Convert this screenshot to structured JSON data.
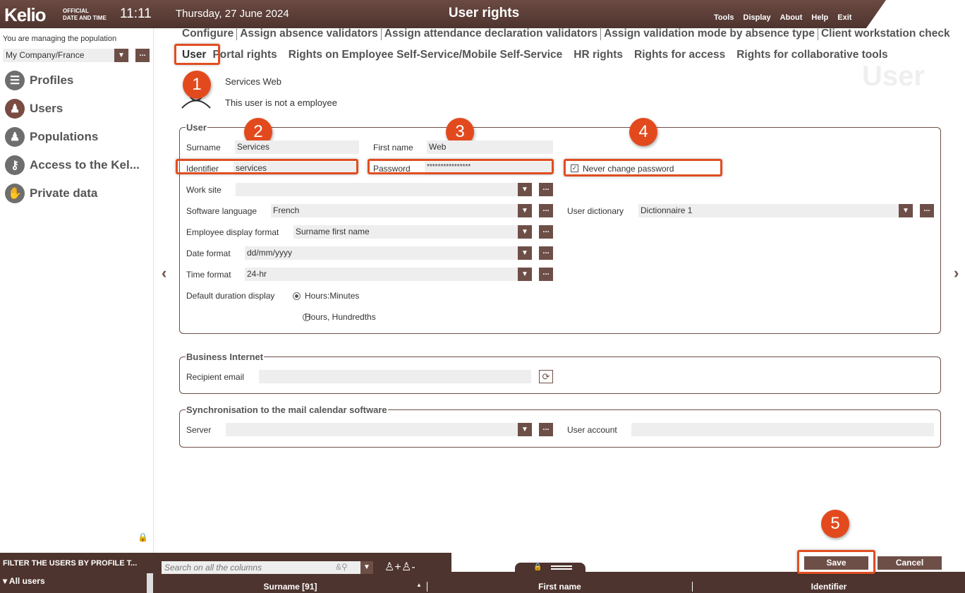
{
  "header": {
    "logo": "Kelio",
    "official_line1": "OFFICIAL",
    "official_line2": "DATE AND TIME",
    "clock": "11:11",
    "date": "Thursday, 27 June 2024",
    "title": "User rights",
    "menu": [
      "Tools",
      "Display",
      "About",
      "Help",
      "Exit"
    ]
  },
  "left": {
    "managing": "You are managing the population",
    "population": "My Company/France",
    "nav": [
      {
        "label": "Profiles",
        "icon": "profiles-icon"
      },
      {
        "label": "Users",
        "icon": "user-icon"
      },
      {
        "label": "Populations",
        "icon": "populations-icon"
      },
      {
        "label": "Access to the Kel...",
        "icon": "key-icon"
      },
      {
        "label": "Private data",
        "icon": "hand-icon"
      }
    ]
  },
  "tabs": {
    "row1": [
      "Configure",
      "Assign absence validators",
      "Assign attendance declaration validators",
      "Assign validation mode by absence type",
      "Client workstation check"
    ],
    "row2": [
      "User",
      "Portal rights",
      "Rights on Employee Self-Service/Mobile Self-Service",
      "HR rights",
      "Rights for access",
      "Rights for collaborative tools"
    ],
    "watermark": "User"
  },
  "user_header": {
    "name": "Services Web",
    "note": "This user is not a employee"
  },
  "badges": [
    "1",
    "2",
    "3",
    "4",
    "5"
  ],
  "user_section": {
    "legend": "User",
    "surname_label": "Surname",
    "surname": "Services",
    "firstname_label": "First name",
    "firstname": "Web",
    "identifier_label": "Identifier",
    "identifier": "services",
    "password_label": "Password",
    "password": "****************",
    "never_change_password": "Never change password",
    "worksite_label": "Work site",
    "worksite": "",
    "software_language_label": "Software language",
    "software_language": "French",
    "user_dictionary_label": "User dictionary",
    "user_dictionary": "Dictionnaire 1",
    "display_format_label": "Employee display format",
    "display_format": "Surname first name",
    "date_format_label": "Date format",
    "date_format": "dd/mm/yyyy",
    "time_format_label": "Time format",
    "time_format": "24-hr",
    "duration_label": "Default duration display",
    "duration_opt1": "Hours:Minutes",
    "duration_opt2": "Hours, Hundredths"
  },
  "business_section": {
    "legend": "Business Internet",
    "email_label": "Recipient email",
    "email": ""
  },
  "sync_section": {
    "legend": "Synchronisation to the mail calendar software",
    "server_label": "Server",
    "server": "",
    "account_label": "User account",
    "account": ""
  },
  "bottom": {
    "filter_title": "FILTER THE USERS BY PROFILE T...",
    "all_users": "All users",
    "search_placeholder": "Search on all the columns",
    "save": "Save",
    "cancel": "Cancel",
    "columns": [
      "Surname [91]",
      "First name",
      "Identifier"
    ]
  }
}
